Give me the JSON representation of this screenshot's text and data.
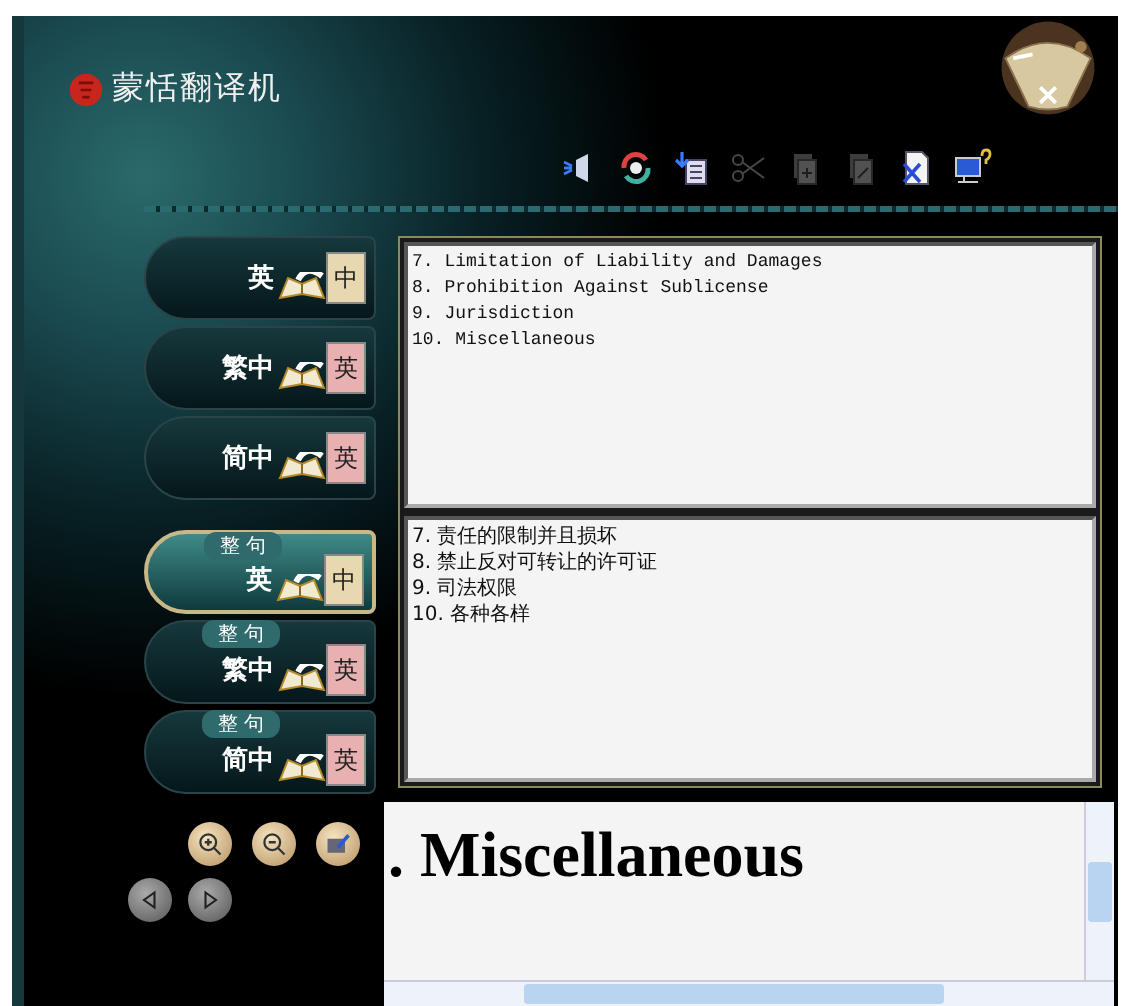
{
  "app": {
    "title": "蒙恬翻译机"
  },
  "toolbar": [
    {
      "kind": "speak",
      "disabled": false
    },
    {
      "kind": "refresh",
      "disabled": false
    },
    {
      "kind": "import",
      "disabled": false
    },
    {
      "kind": "cut",
      "disabled": true
    },
    {
      "kind": "copy",
      "disabled": true
    },
    {
      "kind": "paste",
      "disabled": true
    },
    {
      "kind": "clear",
      "disabled": false
    },
    {
      "kind": "help",
      "disabled": false
    }
  ],
  "modes": [
    {
      "source": "英",
      "target": "中",
      "selected": false
    },
    {
      "source": "繁中",
      "target": "英",
      "selected": false
    },
    {
      "source": "简中",
      "target": "英",
      "selected": false
    },
    {
      "source": "英",
      "target": "中",
      "tag": "整 句",
      "selected": true
    },
    {
      "source": "繁中",
      "target": "英",
      "tag": "整 句",
      "selected": false
    },
    {
      "source": "简中",
      "target": "英",
      "tag": "整 句",
      "selected": false
    }
  ],
  "source_text": [
    "7. Limitation of Liability and Damages",
    "8. Prohibition Against Sublicense",
    "9. Jurisdiction",
    "10. Miscellaneous"
  ],
  "translation_text": [
    "7. 责任的限制并且损坏",
    "8. 禁止反对可转让的许可证",
    "9. 司法权限",
    "10. 各种各样"
  ],
  "preview": {
    "heading": ". Miscellaneous"
  }
}
